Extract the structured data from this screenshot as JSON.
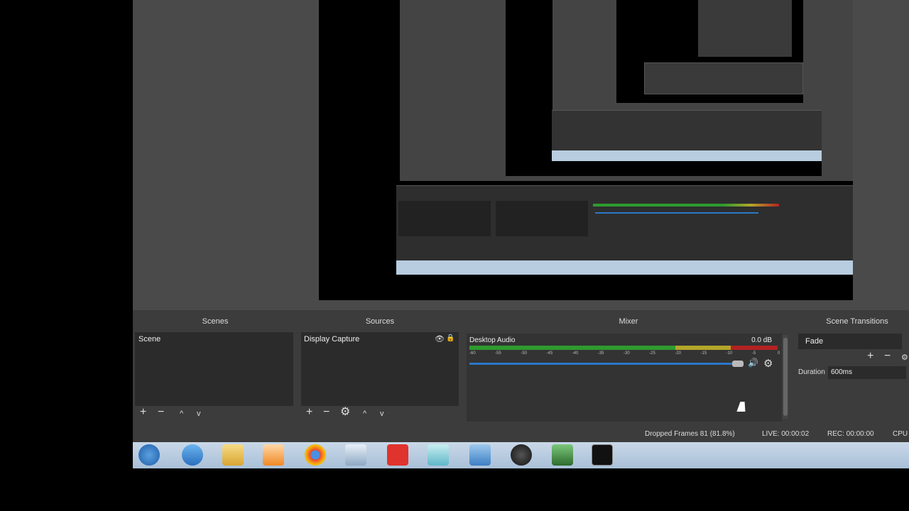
{
  "panels": {
    "scenes": {
      "title": "Scenes",
      "item": "Scene"
    },
    "sources": {
      "title": "Sources",
      "item": "Display Capture"
    },
    "mixer": {
      "title": "Mixer",
      "channel": "Desktop Audio",
      "level": "0.0 dB",
      "ticks": [
        "-60",
        "-55",
        "-50",
        "-45",
        "-40",
        "-35",
        "-30",
        "-25",
        "-20",
        "-15",
        "-10",
        "-5",
        "0"
      ]
    },
    "transitions": {
      "title": "Scene Transitions",
      "selected": "Fade",
      "duration_label": "Duration",
      "duration_value": "600ms"
    }
  },
  "status": {
    "dropped": "Dropped Frames 81 (81.8%)",
    "live": "LIVE: 00:00:02",
    "rec": "REC: 00:00:00",
    "cpu": "CPU"
  },
  "icons": {
    "add": "+",
    "remove": "−",
    "up": "^",
    "down": "v",
    "gear": "⚙",
    "eye": "👁",
    "lock": "🔒",
    "speaker": "🔊"
  },
  "colors": {
    "meter_green": "#2e9b2e",
    "meter_yellow": "#b3a62a",
    "meter_red": "#b32222",
    "slider_blue": "#2b78c8"
  }
}
